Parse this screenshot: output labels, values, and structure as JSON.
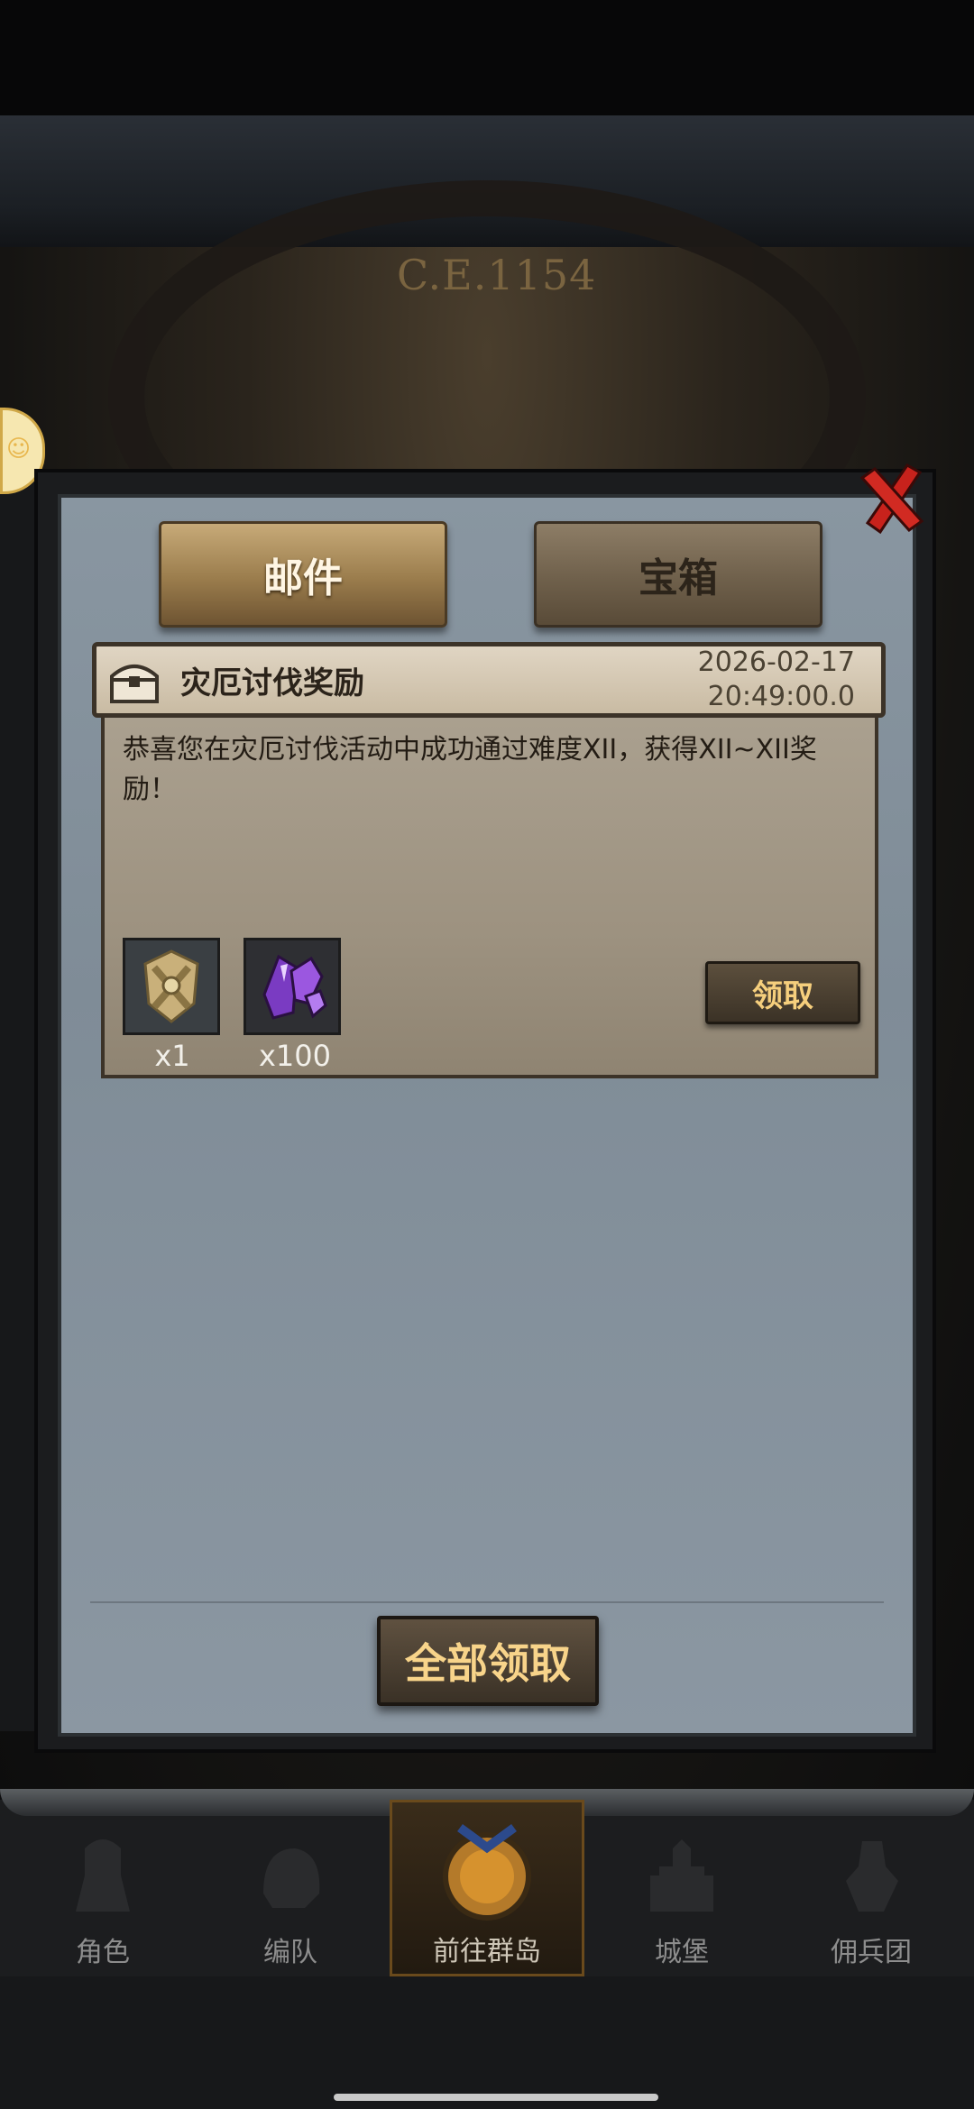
{
  "background": {
    "era_label": "C.E.1154"
  },
  "tabs": [
    {
      "label": "邮件",
      "active": true
    },
    {
      "label": "宝箱",
      "active": false
    }
  ],
  "mail": {
    "title": "灾厄讨伐奖励",
    "date": "2026-02-17",
    "time": "20:49:00.0",
    "body": "恭喜您在灾厄讨伐活动中成功通过难度XII，获得XII~XII奖励！",
    "rewards": [
      {
        "icon": "gold-crest-icon",
        "count": "x1"
      },
      {
        "icon": "purple-crystal-icon",
        "count": "x100"
      }
    ],
    "claim_label": "领取"
  },
  "claim_all_label": "全部领取",
  "nav": [
    {
      "label": "角色",
      "icon": "knight-icon",
      "active": false
    },
    {
      "label": "编队",
      "icon": "helmet-icon",
      "active": false
    },
    {
      "label": "前往群岛",
      "icon": "compass-icon",
      "active": true
    },
    {
      "label": "城堡",
      "icon": "castle-icon",
      "active": false
    },
    {
      "label": "佣兵团",
      "icon": "mercenary-icon",
      "active": false
    }
  ],
  "colors": {
    "accent_gold": "#f8d48a",
    "close_red": "#c8221c",
    "panel_blue_gray": "#8592a0"
  }
}
